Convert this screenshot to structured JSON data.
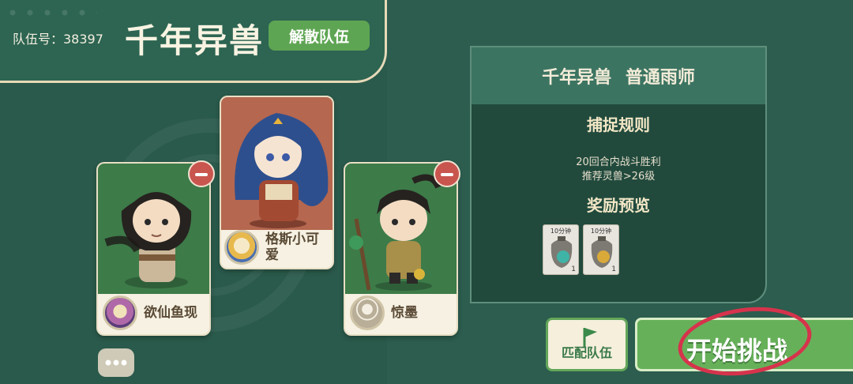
{
  "header": {
    "team_number_label": "队伍号：38397",
    "title": "千年异兽",
    "dismiss_button": "解散队伍"
  },
  "members": [
    {
      "name": "欲仙鱼现",
      "removable": true
    },
    {
      "name": "格斯小可爱",
      "removable": false
    },
    {
      "name": "惊墨",
      "removable": true
    }
  ],
  "info": {
    "title": "千年异兽 普通雨师",
    "rules_heading": "捕捉规则",
    "rules": [
      "20回合内战斗胜利",
      "推荐灵兽>26级"
    ],
    "rewards_heading": "奖励预览",
    "rewards": [
      {
        "tag": "10分钟",
        "count": "1"
      },
      {
        "tag": "10分钟",
        "count": "1"
      }
    ]
  },
  "buttons": {
    "match": "匹配队伍",
    "start": "开始挑战"
  },
  "colors": {
    "accent_green": "#67b05a",
    "remove_red": "#c9554f",
    "annotation_red": "#d6334c"
  }
}
